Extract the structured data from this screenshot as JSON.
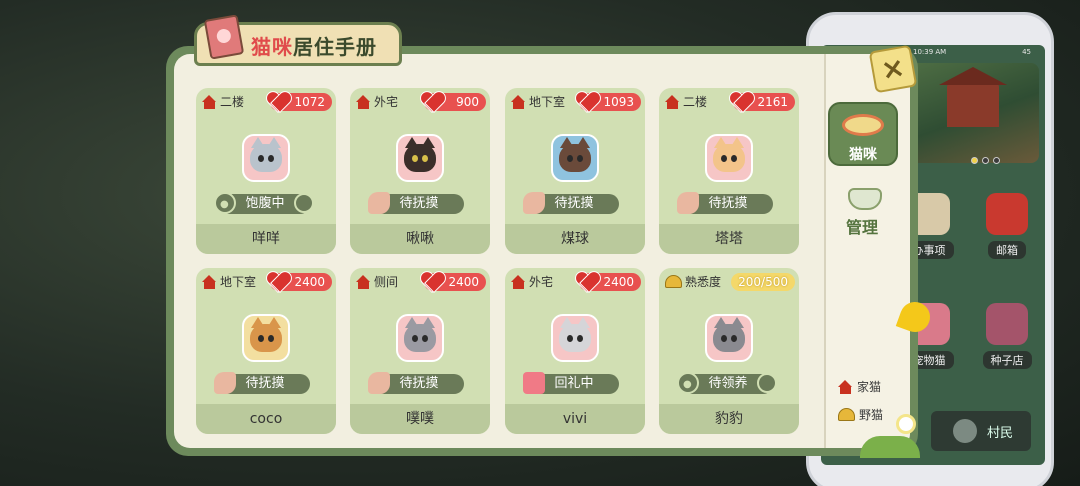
{
  "title": {
    "part1": "猫咪",
    "part2": "居住手册"
  },
  "close_label": "×",
  "side": {
    "tab_label": "猫咪",
    "manage_label": "管理",
    "legend": {
      "house_cat": "家猫",
      "wild_cat": "野猫"
    }
  },
  "cards": [
    {
      "location": "二楼",
      "affection": "1072",
      "status": "饱腹中",
      "name": "咩咩",
      "loc_icon": "house-icon",
      "status_icon": "paw-icon"
    },
    {
      "location": "外宅",
      "affection": "900",
      "status": "待抚摸",
      "name": "啾啾",
      "loc_icon": "house-icon",
      "status_icon": "hand-icon"
    },
    {
      "location": "地下室",
      "affection": "1093",
      "status": "待抚摸",
      "name": "煤球",
      "loc_icon": "house-icon",
      "status_icon": "hand-icon"
    },
    {
      "location": "二楼",
      "affection": "2161",
      "status": "待抚摸",
      "name": "塔塔",
      "loc_icon": "house-icon",
      "status_icon": "hand-icon"
    },
    {
      "location": "地下室",
      "affection": "2400",
      "status": "待抚摸",
      "name": "coco",
      "loc_icon": "house-icon",
      "status_icon": "hand-icon"
    },
    {
      "location": "侧间",
      "affection": "2400",
      "status": "待抚摸",
      "name": "噗噗",
      "loc_icon": "house-icon",
      "status_icon": "hand-icon"
    },
    {
      "location": "外宅",
      "affection": "2400",
      "status": "回礼中",
      "name": "vivi",
      "loc_icon": "house-icon",
      "status_icon": "gift-icon"
    },
    {
      "location": "熟悉度",
      "familiarity": "200/500",
      "status": "待领养",
      "name": "豹豹",
      "loc_icon": "tent-icon",
      "status_icon": "paw-icon"
    }
  ],
  "phone": {
    "time": "10:39 AM",
    "battery": "45",
    "apps": [
      "办事项",
      "邮箱",
      "宠物猫",
      "种子店"
    ],
    "bottom_tab": "村民"
  },
  "colors": {
    "panel_border": "#6d8a5c",
    "card_bg": "#d1dfb3",
    "heart_badge": "#e8514f",
    "familiarity_badge": "#f4d86a",
    "status_pill": "#6a7a58"
  }
}
